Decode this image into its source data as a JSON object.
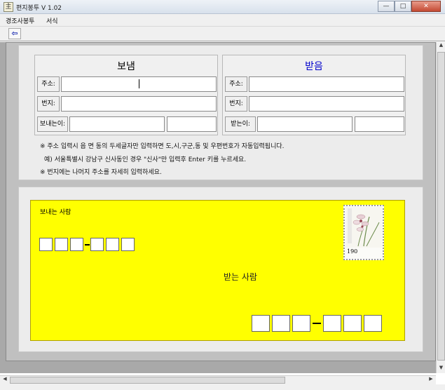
{
  "window": {
    "title": "편지봉투 V 1.02",
    "app_icon_glyph": "主",
    "minimize": "—",
    "maximize": "□",
    "close": "✕"
  },
  "menu": {
    "items": [
      {
        "label": "경조사봉투"
      },
      {
        "label": "서식"
      }
    ]
  },
  "toolbar": {
    "back_icon": "⇦"
  },
  "sender": {
    "title": "보냄",
    "address_label": "주소:",
    "address_value": "",
    "detail_label": "번지:",
    "detail_value": "",
    "name_label": "보내는이:",
    "name_value": "",
    "name_extra_value": ""
  },
  "receiver": {
    "title": "받음",
    "address_label": "주소:",
    "address_value": "",
    "detail_label": "번지:",
    "detail_value": "",
    "name_label": "받는이:",
    "name_value": "",
    "name_extra_value": ""
  },
  "notes": {
    "line1": "※  주소 입력시 읍 면 동의 두세글자만 입력하면 도,시,구군,동 및 우편번호가 자동입력됩니다.",
    "line2": "예) 서울특별시 강남구 신사동인 경우 \"신사\"만 입력후 Enter 키를 누르세요.",
    "line3": "※  번지에는 나머지 주소를 자세히 입력하세요."
  },
  "envelope": {
    "sender_label": "보내는 사람",
    "receiver_label": "받는 사람",
    "stamp_value": "190",
    "colors": {
      "background": "#ffff00",
      "receiver_title": "#0000cc"
    }
  },
  "icons": [
    "app-icon",
    "back-arrow-icon",
    "stamp-orchid-icon",
    "scroll-up-icon",
    "scroll-down-icon",
    "scroll-left-icon",
    "scroll-right-icon"
  ]
}
